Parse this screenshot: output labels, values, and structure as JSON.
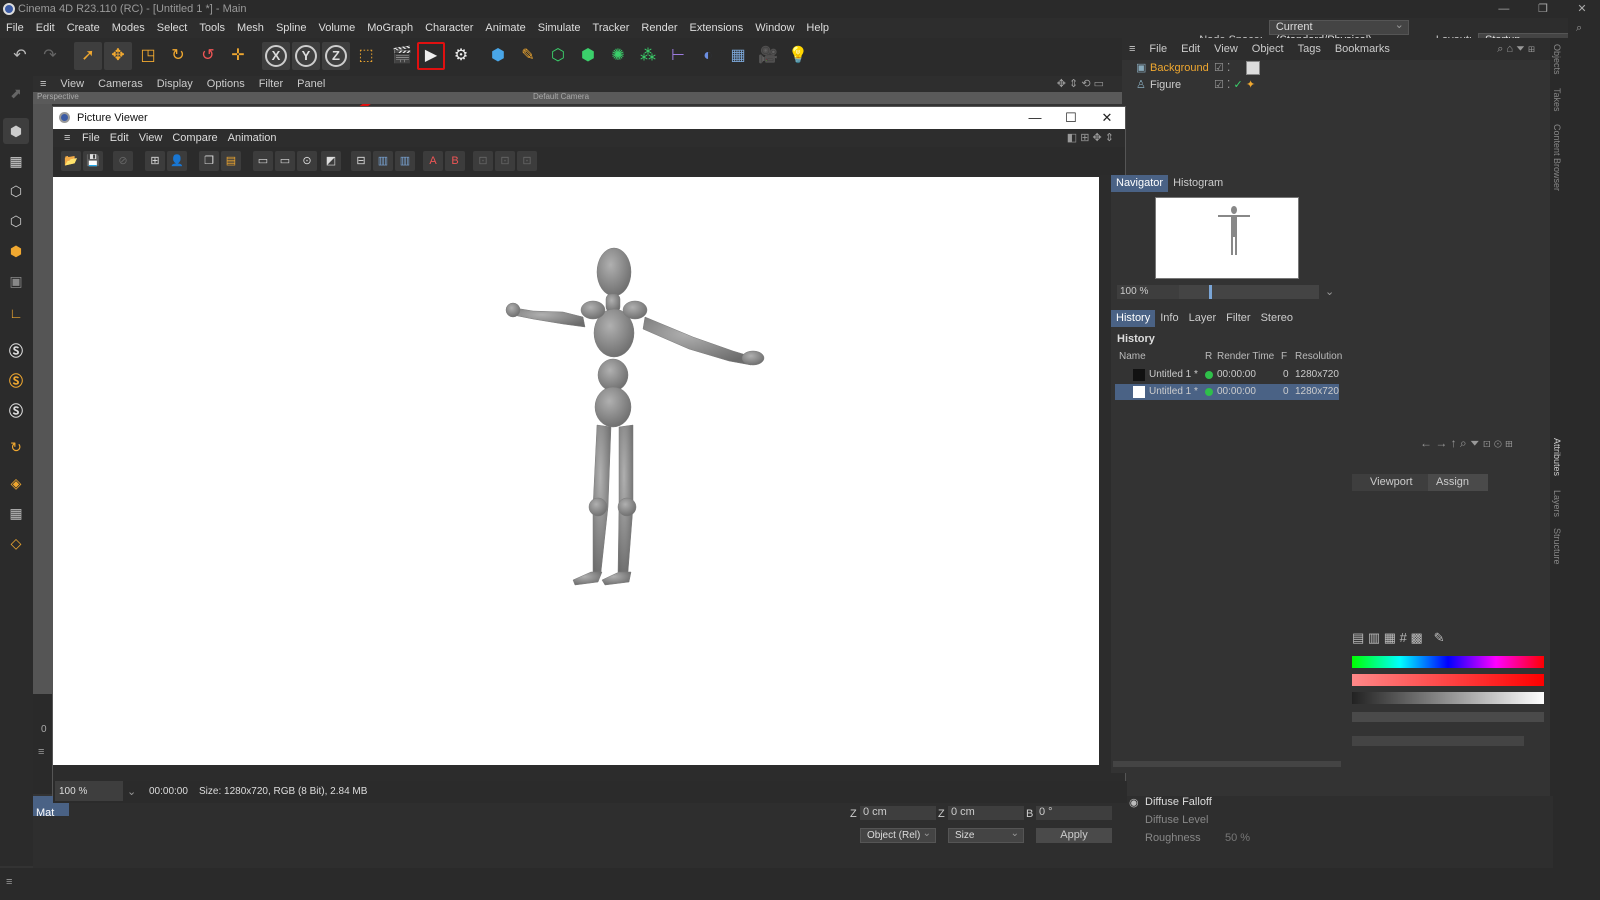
{
  "app": {
    "title": "Cinema 4D R23.110 (RC) - [Untitled 1 *] - Main"
  },
  "menubar": {
    "items": [
      "File",
      "Edit",
      "Create",
      "Modes",
      "Select",
      "Tools",
      "Mesh",
      "Spline",
      "Volume",
      "MoGraph",
      "Character",
      "Animate",
      "Simulate",
      "Tracker",
      "Render",
      "Extensions",
      "Window",
      "Help"
    ],
    "node_space_label": "Node Space:",
    "node_space_value": "Current (Standard/Physical)",
    "layout_label": "Layout:",
    "layout_value": "Startup"
  },
  "toolbar": {
    "icons": [
      "undo-icon",
      "redo-icon",
      "select-icon",
      "move-icon",
      "scale-icon",
      "rotate-icon",
      "psr-icon",
      "move-axis-icon",
      "x-axis-icon",
      "y-axis-icon",
      "z-axis-icon",
      "coordinate-icon",
      "render-region-icon",
      "render-view-icon",
      "render-settings-icon",
      "cube-icon",
      "pen-icon",
      "subdivide-icon",
      "extrude-icon",
      "cloner-icon",
      "array-icon",
      "deformer-icon",
      "field-icon",
      "floor-icon",
      "camera-icon",
      "light-icon"
    ],
    "axis_labels": [
      "X",
      "Y",
      "Z"
    ]
  },
  "viewport": {
    "menu": [
      "View",
      "Cameras",
      "Display",
      "Options",
      "Filter",
      "Panel"
    ],
    "perspective_label": "Perspective",
    "camera_label": "Default Camera"
  },
  "objects": {
    "menu": [
      "File",
      "Edit",
      "View",
      "Object",
      "Tags",
      "Bookmarks"
    ],
    "rows": [
      {
        "name": "Background",
        "color": "#f0a830"
      },
      {
        "name": "Figure",
        "color": "#cccccc"
      }
    ]
  },
  "side_tabs": [
    "Objects",
    "Takes",
    "Content Browser",
    "Attributes",
    "Layers",
    "Structure"
  ],
  "attributes": {
    "viewport_btn": "Viewport",
    "assign_btn": "Assign",
    "diffuse_falloff": "Diffuse Falloff",
    "diffuse_level": "Diffuse Level",
    "roughness": "Roughness",
    "roughness_value": "50 %"
  },
  "picture_viewer": {
    "title": "Picture Viewer",
    "menu": [
      "File",
      "Edit",
      "View",
      "Compare",
      "Animation"
    ],
    "nav_tabs": [
      "Navigator",
      "Histogram"
    ],
    "zoom": "100 %",
    "info_tabs": [
      "History",
      "Info",
      "Layer",
      "Filter",
      "Stereo"
    ],
    "history_title": "History",
    "history_headers": [
      "Name",
      "R",
      "Render Time",
      "F",
      "Resolution"
    ],
    "history_rows": [
      {
        "name": "Untitled 1 *",
        "time": "00:00:00",
        "frame": "0",
        "res": "1280x720"
      },
      {
        "name": "Untitled 1 *",
        "time": "00:00:00",
        "frame": "0",
        "res": "1280x720"
      }
    ],
    "status_zoom": "100 %",
    "status_time": "00:00:00",
    "status_info": "Size: 1280x720, RGB (8 Bit), 2.84 MB"
  },
  "coords": {
    "z1_label": "Z",
    "z1_value": "0 cm",
    "z2_label": "Z",
    "z2_value": "0 cm",
    "b_label": "B",
    "b_value": "0 °",
    "mode": "Object (Rel)",
    "size_mode": "Size",
    "apply": "Apply"
  },
  "material": {
    "label": "Mat"
  },
  "timeline": {
    "frame": "0"
  },
  "colors": {
    "accent": "#4a6285",
    "highlight": "#e01010",
    "render_green": "#2fbf4a"
  }
}
